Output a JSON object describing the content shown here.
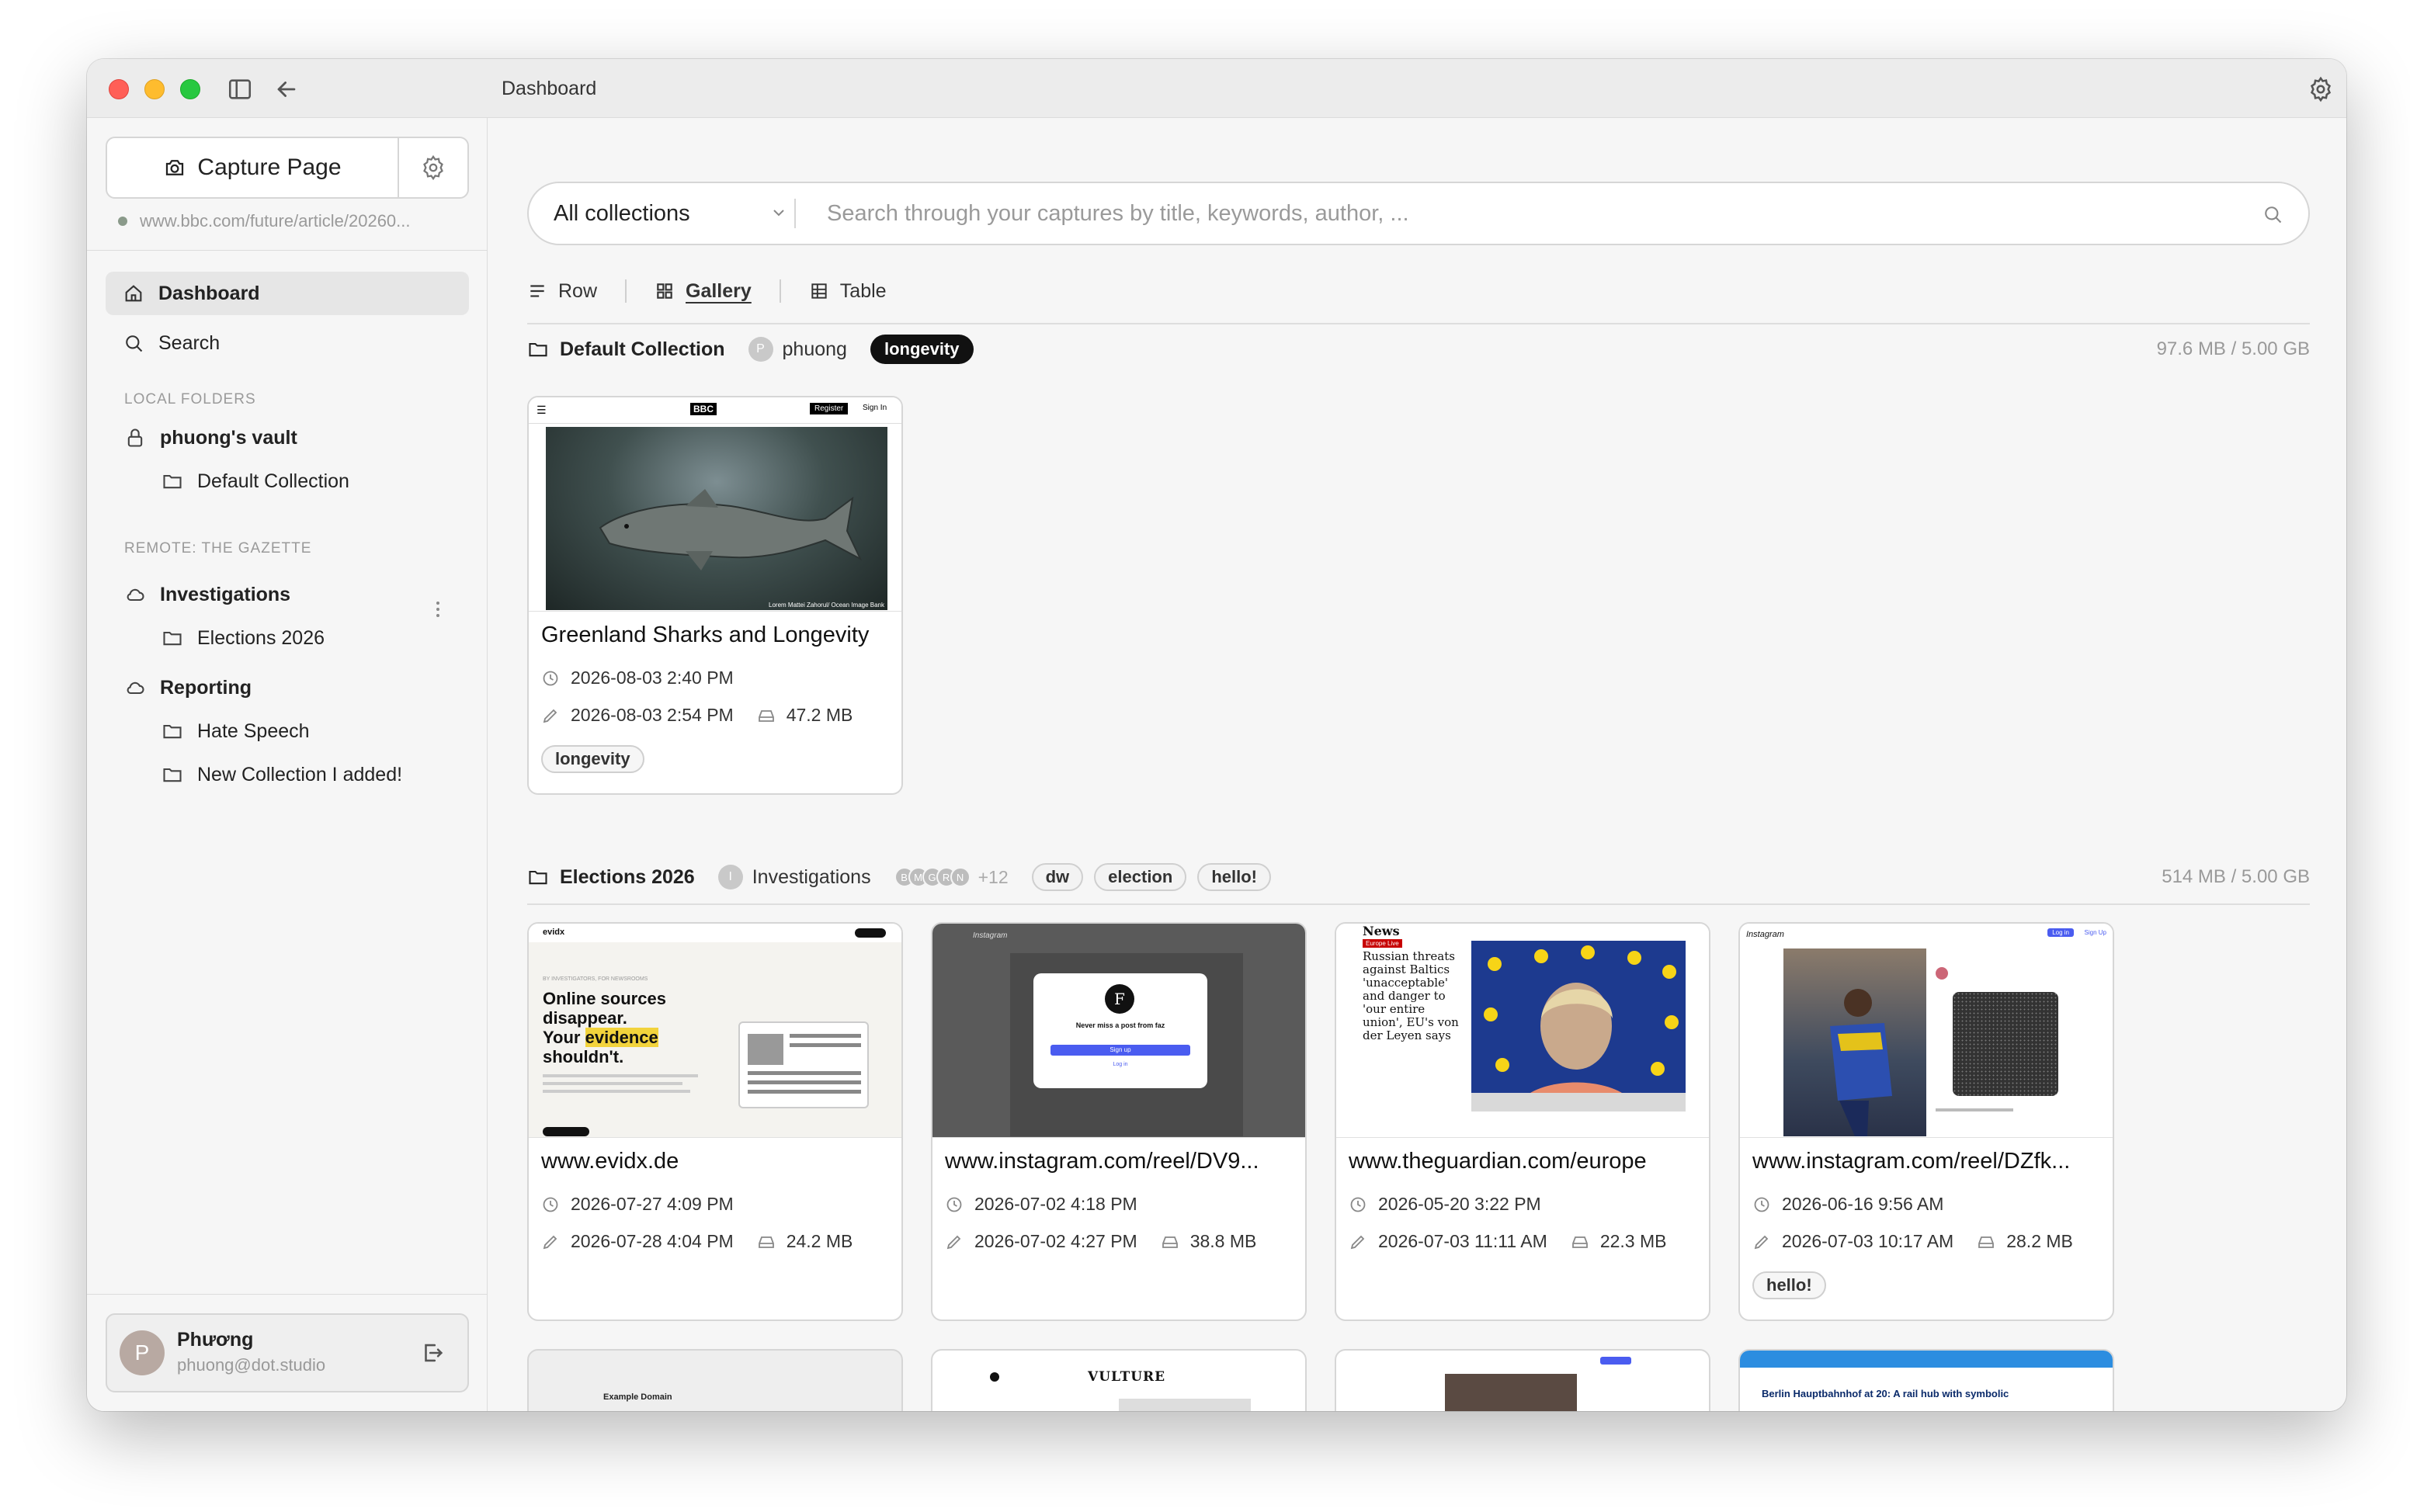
{
  "window": {
    "title": "Dashboard"
  },
  "sidebar": {
    "capture_label": "Capture Page",
    "current_url": "www.bbc.com/future/article/20260...",
    "nav": [
      {
        "label": "Dashboard",
        "icon": "home-icon",
        "active": true
      },
      {
        "label": "Search",
        "icon": "search-icon",
        "active": false
      }
    ],
    "local_label": "LOCAL FOLDERS",
    "vault": "phuong's vault",
    "vault_children": [
      "Default Collection"
    ],
    "remote_label": "REMOTE: THE GAZETTE",
    "remote_groups": [
      {
        "label": "Investigations",
        "children": [
          "Elections 2026"
        ]
      },
      {
        "label": "Reporting",
        "children": [
          "Hate Speech",
          "New Collection I added!"
        ]
      }
    ],
    "user": {
      "initial": "P",
      "name": "Phương",
      "email": "phuong@dot.studio"
    }
  },
  "search": {
    "collection": "All collections",
    "placeholder": "Search through your captures by title, keywords, author, ..."
  },
  "views": [
    "Row",
    "Gallery",
    "Table"
  ],
  "active_view": "Gallery",
  "groups": [
    {
      "title": "Default Collection",
      "owner": "phuong",
      "owner_initial": "P",
      "tags": [
        "longevity"
      ],
      "size": "97.6 MB / 5.00 GB",
      "cards": [
        {
          "title": "Greenland Sharks and Longevity",
          "created": "2026-08-03 2:40 PM",
          "edited": "2026-08-03 2:54 PM",
          "size": "47.2 MB",
          "tags": [
            "longevity"
          ]
        }
      ]
    },
    {
      "title": "Elections 2026",
      "owner": "Investigations",
      "owner_initial": "I",
      "members": [
        "B",
        "M",
        "G",
        "R",
        "N"
      ],
      "members_more": "+12",
      "tags": [
        "dw",
        "election",
        "hello!"
      ],
      "size": "514 MB / 5.00 GB",
      "cards": [
        {
          "title": "www.evidx.de",
          "created": "2026-07-27 4:09 PM",
          "edited": "2026-07-28 4:04 PM",
          "size": "24.2 MB",
          "tags": []
        },
        {
          "title": "www.instagram.com/reel/DV9...",
          "created": "2026-07-02 4:18 PM",
          "edited": "2026-07-02 4:27 PM",
          "size": "38.8 MB",
          "tags": []
        },
        {
          "title": "www.theguardian.com/europe",
          "created": "2026-05-20 3:22 PM",
          "edited": "2026-07-03 11:11 AM",
          "size": "22.3 MB",
          "tags": []
        },
        {
          "title": "www.instagram.com/reel/DZfk...",
          "created": "2026-06-16 9:56 AM",
          "edited": "2026-07-03 10:17 AM",
          "size": "28.2 MB",
          "tags": [
            "hello!"
          ]
        }
      ]
    }
  ],
  "thumbs": {
    "bbc": {
      "logo": "BBC",
      "register": "Register",
      "signin": "Sign In",
      "caption": "Lorem Mattei Zahorul/ Ocean Image Bank"
    },
    "evidx": {
      "brand": "evidx",
      "kicker": "BY INVESTIGATORS, FOR NEWSROOMS",
      "headline_1": "Online sources",
      "headline_2": "disappear.",
      "headline_3": "Your",
      "headline_hl": "evidence",
      "headline_4": "shouldn't."
    },
    "insta1": {
      "brand": "Instagram",
      "modal_text": "Never miss a post from faz",
      "modal_btn": "Sign up",
      "modal_link": "Log in"
    },
    "guardian": {
      "section": "News",
      "label": "Europe Live",
      "headline": "Russian threats against Baltics 'unacceptable' and danger to 'our entire union', EU's von der Leyen says"
    },
    "insta2": {
      "brand": "Instagram",
      "login": "Log in",
      "signup": "Sign Up"
    },
    "peek1": "Example Domain",
    "peek2": "VULTURE",
    "peek4": "Berlin Hauptbahnhof at 20: A rail hub with symbolic"
  }
}
